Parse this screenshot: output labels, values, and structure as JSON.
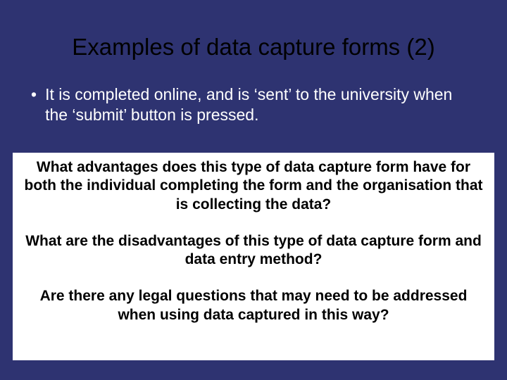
{
  "title": "Examples of data capture forms (2)",
  "bullet": {
    "marker": "•",
    "text": "It is completed online, and is ‘sent’ to the university when the ‘submit’ button is pressed."
  },
  "questions": {
    "q1": "What advantages does this type of data capture form have for both the individual completing the form and the organisation that is collecting the data?",
    "q2": "What are the disadvantages of this type of data capture form and data entry method?",
    "q3": "Are there any legal questions that may need to be addressed when using data captured in this way?"
  }
}
